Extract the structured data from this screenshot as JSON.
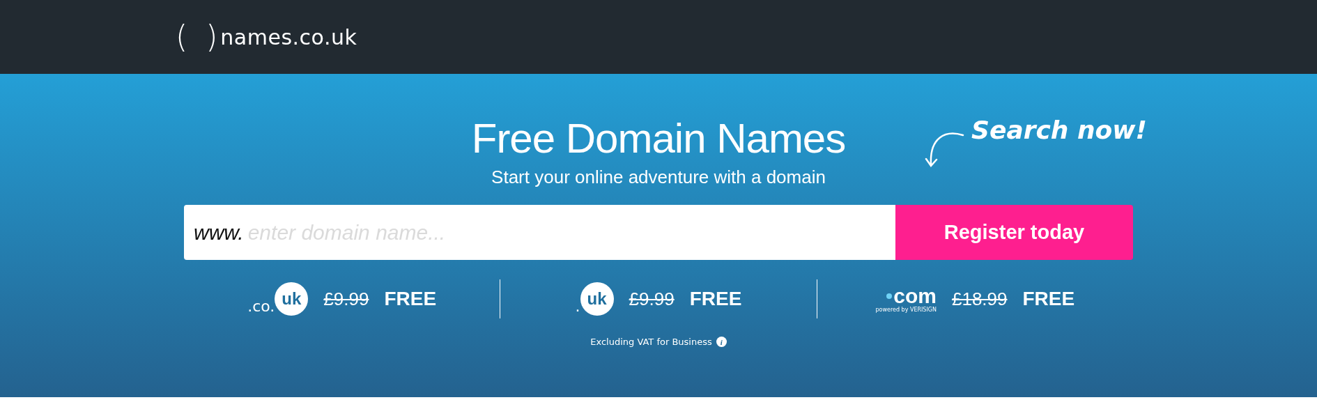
{
  "header": {
    "logo": {
      "mark_left": "(",
      "mark_right": ")",
      "name": "names.co.uk"
    }
  },
  "hero": {
    "title": "Free Domain Names",
    "subtitle": "Start your online adventure with a domain",
    "callout": "Search now!"
  },
  "search": {
    "prefix": "www.",
    "placeholder": "enter domain name...",
    "button": "Register today"
  },
  "offers": [
    {
      "kind": "badge",
      "prefix": ".co.",
      "badge": "uk",
      "old_price": "£9.99",
      "price": "FREE"
    },
    {
      "kind": "badge",
      "prefix": ".",
      "badge": "uk",
      "old_price": "£9.99",
      "price": "FREE"
    },
    {
      "kind": "com",
      "name": "com",
      "tagline": "powered by VERISIGN",
      "old_price": "£18.99",
      "price": "FREE"
    }
  ],
  "note": {
    "text": "Excluding VAT for Business",
    "icon": "i"
  }
}
